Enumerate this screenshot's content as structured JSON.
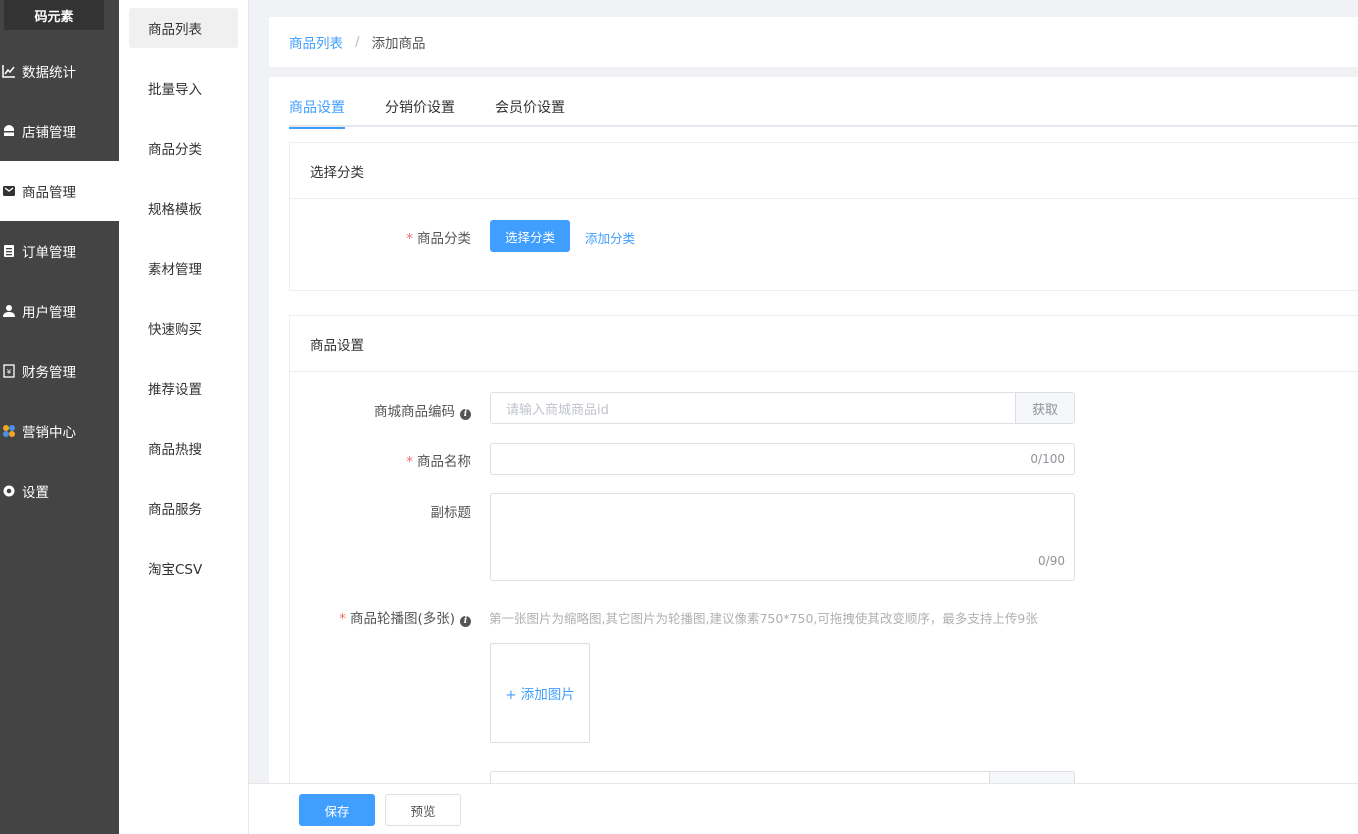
{
  "app": {
    "logo": "码元素"
  },
  "sidebar": {
    "items": [
      {
        "label": "数据统计",
        "icon": "chart-line-icon",
        "active": false
      },
      {
        "label": "店铺管理",
        "icon": "store-icon",
        "active": false
      },
      {
        "label": "商品管理",
        "icon": "goods-icon",
        "active": true
      },
      {
        "label": "订单管理",
        "icon": "clipboard-icon",
        "active": false
      },
      {
        "label": "用户管理",
        "icon": "user-icon",
        "active": false
      },
      {
        "label": "财务管理",
        "icon": "finance-icon",
        "active": false
      },
      {
        "label": "营销中心",
        "icon": "marketing-icon",
        "active": false
      },
      {
        "label": "设置",
        "icon": "gear-icon",
        "active": false
      }
    ]
  },
  "subnav": {
    "items": [
      "商品列表",
      "批量导入",
      "商品分类",
      "规格模板",
      "素材管理",
      "快速购买",
      "推荐设置",
      "商品热搜",
      "商品服务",
      "淘宝CSV"
    ],
    "active_index": 0
  },
  "breadcrumb": {
    "parent": "商品列表",
    "separator": "/",
    "current": "添加商品"
  },
  "tabs": [
    "商品设置",
    "分销价设置",
    "会员价设置"
  ],
  "category_card": {
    "title": "选择分类",
    "label": "商品分类",
    "select_button": "选择分类",
    "add_link": "添加分类"
  },
  "goods_card": {
    "title": "商品设置",
    "code": {
      "label": "商城商品编码",
      "placeholder": "请输入商城商品id",
      "append": "获取"
    },
    "name": {
      "label": "商品名称",
      "value": "",
      "count": "0/100"
    },
    "subtitle": {
      "label": "副标题",
      "value": "",
      "count": "0/90"
    },
    "carousel": {
      "label": "商品轮播图(多张)",
      "hint": "第一张图片为缩略图,其它图片为轮播图,建议像素750*750,可拖拽使其改变顺序，最多支持上传9张",
      "upload_label": "+ 添加图片"
    }
  },
  "footer": {
    "save": "保存",
    "preview": "预览"
  },
  "colors": {
    "primary": "#409eff",
    "sidebar_bg": "#444444",
    "required": "#f56c6c"
  }
}
